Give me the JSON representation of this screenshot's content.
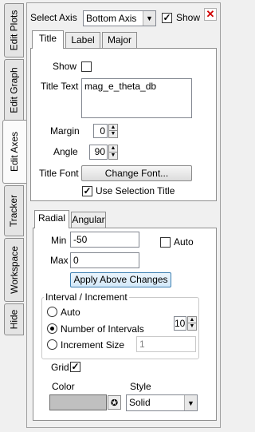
{
  "side_tabs": [
    "Edit Plots",
    "Edit Graph",
    "Edit Axes",
    "Tracker",
    "Workspace",
    "Hide"
  ],
  "active_side_tab": "Edit Axes",
  "header": {
    "select_axis_label": "Select Axis",
    "select_axis_value": "Bottom Axis",
    "show_label": "Show",
    "show_checked": true,
    "close_icon": "close-icon"
  },
  "upper_tabs": [
    "Title",
    "Label",
    "Major"
  ],
  "active_upper_tab": "Title",
  "title_panel": {
    "show_label": "Show",
    "show_checked": false,
    "title_text_label": "Title Text",
    "title_text_value": "mag_e_theta_db",
    "margin_label": "Margin",
    "margin_value": "0",
    "angle_label": "Angle",
    "angle_value": "90",
    "title_font_label": "Title Font",
    "change_font_button": "Change Font...",
    "use_selection_title_label": "Use Selection Title",
    "use_selection_title_checked": true
  },
  "lower_tabs": [
    "Radial",
    "Angular"
  ],
  "active_lower_tab": "Radial",
  "range_panel": {
    "min_label": "Min",
    "min_value": "-50",
    "max_label": "Max",
    "max_value": "0",
    "auto_label": "Auto",
    "auto_checked": false,
    "apply_button": "Apply Above Changes",
    "interval_group_label": "Interval / Increment",
    "interval_options": [
      "Auto",
      "Number of Intervals",
      "Increment Size"
    ],
    "interval_selected": "Number of Intervals",
    "num_intervals_value": "10",
    "increment_size_value": "1",
    "grid_label": "Grid",
    "grid_checked": true,
    "color_label": "Color",
    "style_label": "Style",
    "grid_color": "#c0c0c0",
    "style_value": "Solid"
  }
}
